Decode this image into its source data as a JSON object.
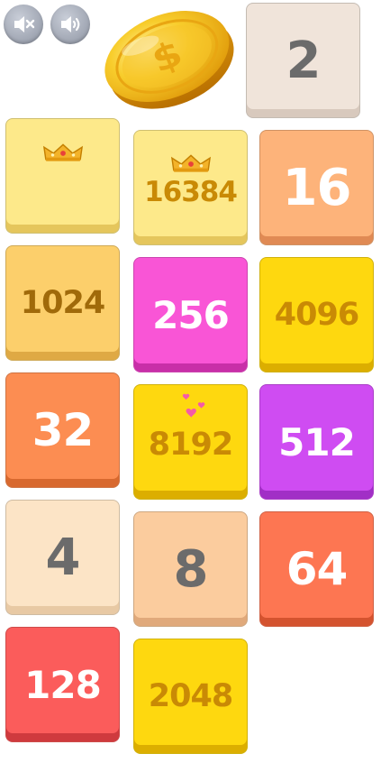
{
  "controls": {
    "mute_icon": "speaker-mute-icon",
    "volume_icon": "speaker-volume-icon",
    "coin_icon": "gold-coin-icon"
  },
  "colors": {
    "tile_2": "#f0e4da",
    "tile_4": "#fce4c6",
    "tile_8": "#fbcc9e",
    "tile_16": "#fdb37a",
    "tile_32": "#fc8d52",
    "tile_64": "#fd7652",
    "tile_128": "#fb5c5b",
    "tile_256": "#f955d6",
    "tile_512": "#cf4cf2",
    "tile_1024": "#fccf6b",
    "tile_2048": "#fed80f",
    "tile_16384": "#fde98a",
    "coin": "#f6c21a"
  },
  "next_tile": {
    "value": "2"
  },
  "board": {
    "tiles": [
      {
        "value": "",
        "badge": "crown-icon"
      },
      {
        "value": "16384",
        "badge": "crown-icon"
      },
      {
        "value": "16"
      },
      {
        "value": "1024"
      },
      {
        "value": "256"
      },
      {
        "value": "4096"
      },
      {
        "value": "32"
      },
      {
        "value": "8192",
        "badge": "hearts-icon"
      },
      {
        "value": "512"
      },
      {
        "value": "4"
      },
      {
        "value": "8"
      },
      {
        "value": "64"
      },
      {
        "value": "128"
      },
      {
        "value": "2048"
      }
    ]
  }
}
